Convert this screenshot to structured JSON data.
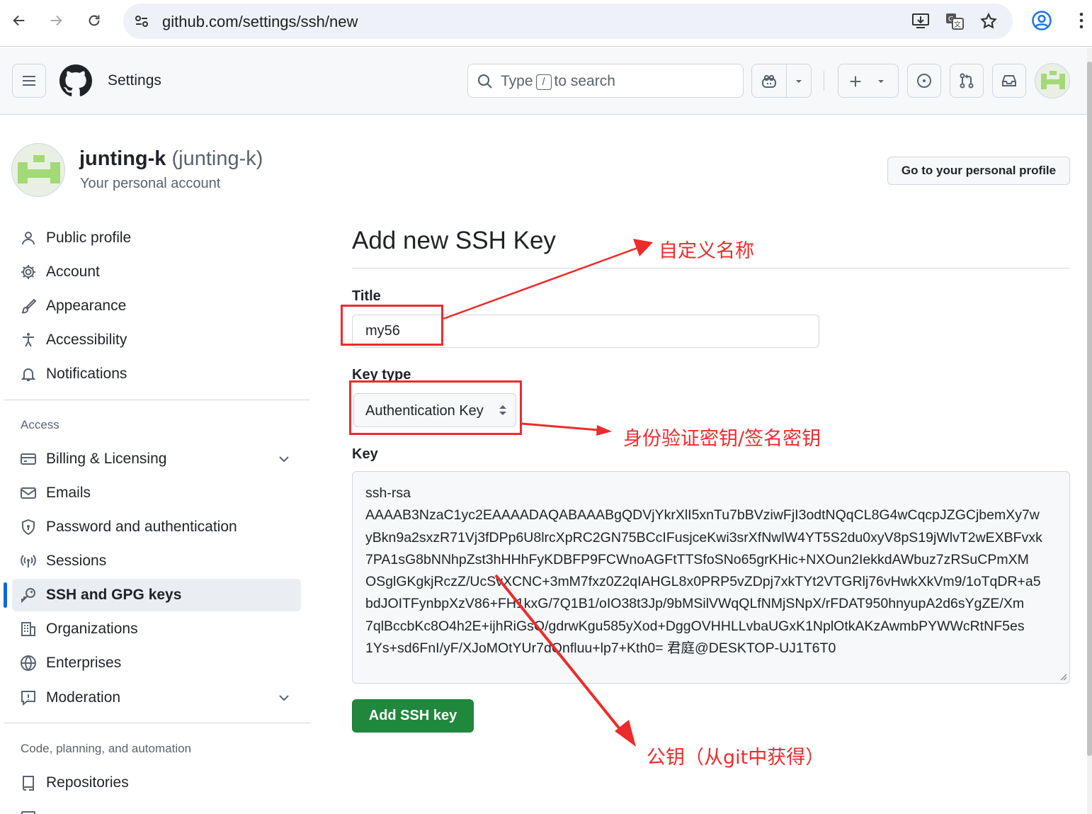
{
  "browser": {
    "url": "github.com/settings/ssh/new"
  },
  "header": {
    "title": "Settings",
    "search_before": "Type",
    "search_key": "/",
    "search_after": "to search"
  },
  "account": {
    "name": "junting-k",
    "login": "(junting-k)",
    "subtitle": "Your personal account",
    "profile_button": "Go to your personal profile"
  },
  "sidebar": {
    "items": [
      {
        "label": "Public profile",
        "icon": "person-icon"
      },
      {
        "label": "Account",
        "icon": "gear-icon"
      },
      {
        "label": "Appearance",
        "icon": "paintbrush-icon"
      },
      {
        "label": "Accessibility",
        "icon": "accessibility-icon"
      },
      {
        "label": "Notifications",
        "icon": "bell-icon"
      }
    ],
    "access_heading": "Access",
    "access_items": [
      {
        "label": "Billing & Licensing",
        "icon": "credit-card-icon"
      },
      {
        "label": "Emails",
        "icon": "mail-icon"
      },
      {
        "label": "Password and authentication",
        "icon": "shield-lock-icon"
      },
      {
        "label": "Sessions",
        "icon": "broadcast-icon"
      },
      {
        "label": "SSH and GPG keys",
        "icon": "key-icon",
        "active": true
      },
      {
        "label": "Organizations",
        "icon": "organization-icon"
      },
      {
        "label": "Enterprises",
        "icon": "globe-icon"
      },
      {
        "label": "Moderation",
        "icon": "report-icon"
      }
    ],
    "code_heading": "Code, planning, and automation",
    "code_items": [
      {
        "label": "Repositories",
        "icon": "repo-icon"
      }
    ]
  },
  "main": {
    "title": "Add new SSH Key",
    "title_label": "Title",
    "title_value": "my56",
    "key_type_label": "Key type",
    "key_type_value": "Authentication Key",
    "key_label": "Key",
    "key_lines": [
      "ssh-rsa",
      "AAAAB3NzaC1yc2EAAAADAQABAAABgQDVjYkrXlI5xnTu7bBVziwFjI3odtNQqCL8G4wCqcpJZGCjbemXy7w",
      "yBkn9a2sxzR71Vj3fDPp6U8lrcXpRC2GN75BCcIFusjceKwi3srXfNwlW4YT5S2du0xyV8pS19jWlvT2wEXBFvxk",
      "7PA1sG8bNNhpZst3hHHhFyKDBFP9FCWnoAGFtTTSfoSNo65grKHic+NXOun2IekkdAWbuz7zRSuCPmXM",
      "OSglGKgkjRczZ/UcSvXCNC+3mM7fxz0Z2qIAHGL8x0PRP5vZDpj7xkTYt2VTGRlj76vHwkXkVm9/1oTqDR+a5",
      "bdJOITFynbpXzV86+FH1kxG/7Q1B1/oIO38t3Jp/9bMSilVWqQLfNMjSNpX/rFDAT950hnyupA2d6sYgZE/Xm",
      "7qlBccbKc8O4h2E+ijhRiGsO/gdrwKgu585yXod+DggOVHHLLvbaUGxK1NplOtkAKzAwmbPYWWcRtNF5es",
      "1Ys+sd6FnI/yF/XJoMOtYUr7dQnfluu+lp7+Kth0= 君庭@DESKTOP-UJ1T6T0"
    ],
    "submit_label": "Add SSH key"
  },
  "annotations": {
    "title_note": "自定义名称",
    "key_type_note": "身份验证密钥/签名密钥",
    "key_note": "公钥（从git中获得）",
    "color": "#ee2b2b"
  },
  "colors": {
    "accent": "#0969da",
    "primary_button": "#1f883d"
  }
}
